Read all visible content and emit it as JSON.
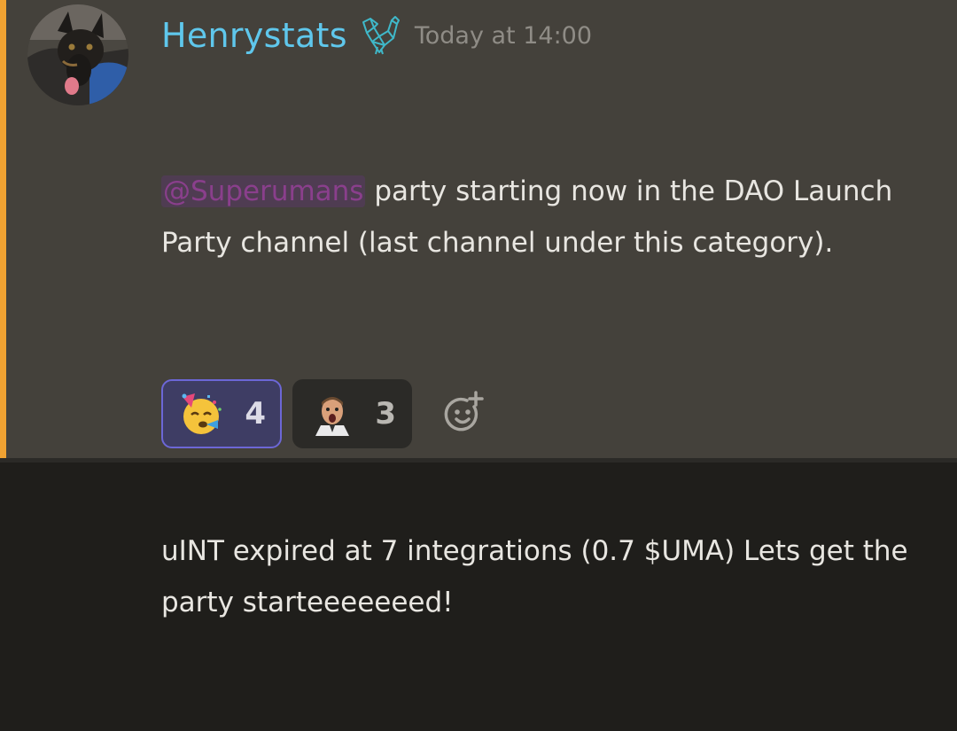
{
  "colors": {
    "accent_bar": "#f0a232",
    "username": "#5fc7ec",
    "mention": "#8a3f8c",
    "active_reaction_border": "#6c67d6"
  },
  "message": {
    "avatar_icon": "avatar-dog",
    "username": "Henrystats",
    "badge_icon": "rooster-icon",
    "timestamp": "Today at 14:00",
    "mention": "@Superumans",
    "line1_rest": " party starting now in the DAO Launch Party channel (last channel under this category).",
    "line2": "uINT expired at 7 integrations (0.7 $UMA) Lets get the party starteeeeeeed!"
  },
  "reactions": [
    {
      "emoji": "partying-face-emoji",
      "count": "4",
      "reacted": true
    },
    {
      "emoji": "shocked-man-emoji",
      "count": "3",
      "reacted": false
    }
  ],
  "add_reaction_icon": "add-reaction-icon"
}
